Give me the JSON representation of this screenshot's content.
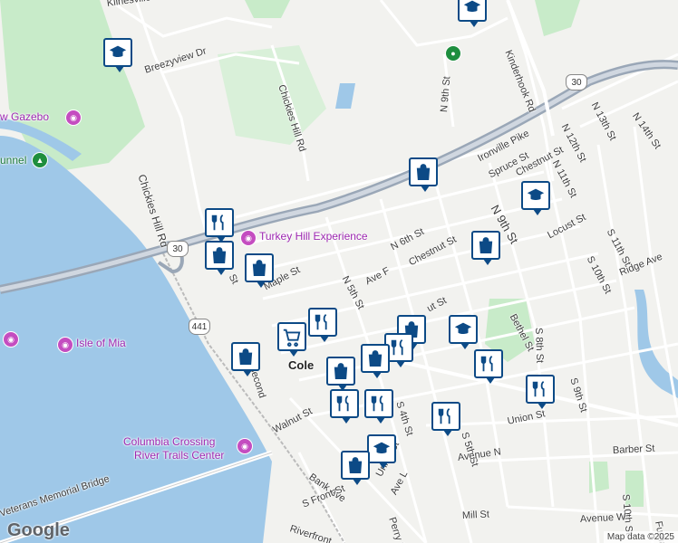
{
  "map": {
    "google_logo": "Google",
    "attribution": "Map data ©2025",
    "colors": {
      "water": "#9fc8e8",
      "park": "#c8ebc9",
      "road": "#ffffff",
      "highway": "#9aa7b7",
      "marker_border": "#0c4a86",
      "poi": "#9c27b0"
    }
  },
  "streets": [
    {
      "name": "Klinesville",
      "id": "klinesville"
    },
    {
      "name": "Breezyview Dr",
      "id": "breezyview"
    },
    {
      "name": "Chickies Hill Rd",
      "id": "chickies-hill-rd-1"
    },
    {
      "name": "Chickies Hill Rd",
      "id": "chickies-hill-rd-2"
    },
    {
      "name": "Kinderhook Rd",
      "id": "kinderhook"
    },
    {
      "name": "N 9th St",
      "id": "n9th-top"
    },
    {
      "name": "N 14th St",
      "id": "n14th"
    },
    {
      "name": "N 13th St",
      "id": "n13th"
    },
    {
      "name": "N 12th St",
      "id": "n12th"
    },
    {
      "name": "N 11th St",
      "id": "n11th"
    },
    {
      "name": "Ironville Pike",
      "id": "ironville"
    },
    {
      "name": "Spruce St",
      "id": "spruce"
    },
    {
      "name": "Chestnut St",
      "id": "chestnut-e"
    },
    {
      "name": "N 9th St",
      "id": "n9th"
    },
    {
      "name": "Locust St",
      "id": "locust-e"
    },
    {
      "name": "S 11th St",
      "id": "s11th"
    },
    {
      "name": "S 10th St",
      "id": "s10th"
    },
    {
      "name": "Ridge Ave",
      "id": "ridge"
    },
    {
      "name": "N 6th St",
      "id": "n6th"
    },
    {
      "name": "Chestnut St",
      "id": "chestnut"
    },
    {
      "name": "N 5th St",
      "id": "n5th"
    },
    {
      "name": "Ave F",
      "id": "avef"
    },
    {
      "name": "Maple St",
      "id": "maple"
    },
    {
      "name": "Walnut St",
      "id": "walnut"
    },
    {
      "name": "Bethel St",
      "id": "bethel"
    },
    {
      "name": "S 8th St",
      "id": "s8th"
    },
    {
      "name": "S 9th St",
      "id": "s9th"
    },
    {
      "name": "Union St",
      "id": "union-e"
    },
    {
      "name": "S 5th St",
      "id": "s5th"
    },
    {
      "name": "S 4th St",
      "id": "s4th"
    },
    {
      "name": "Avenue N",
      "id": "aven"
    },
    {
      "name": "Barber St",
      "id": "barber"
    },
    {
      "name": "S 10th St",
      "id": "s10th-b"
    },
    {
      "name": "Union St",
      "id": "union"
    },
    {
      "name": "Ave L",
      "id": "avel"
    },
    {
      "name": "Bank Ave",
      "id": "bank"
    },
    {
      "name": "S Front St",
      "id": "sfront"
    },
    {
      "name": "Perry St",
      "id": "perry"
    },
    {
      "name": "Mill St",
      "id": "mill"
    },
    {
      "name": "Avenue W",
      "id": "avew"
    },
    {
      "name": "Riverfront",
      "id": "riverfront"
    },
    {
      "name": "Furnac",
      "id": "furnace"
    },
    {
      "name": "Chickies Hill Rd",
      "id": "chickies-main"
    },
    {
      "name": "Second",
      "id": "second"
    },
    {
      "name": "Veterans Memorial Bridge",
      "id": "veterans"
    },
    {
      "name": "Lo",
      "id": "lo"
    },
    {
      "name": "ut St",
      "id": "ut-st"
    },
    {
      "name": "St",
      "id": "st1"
    },
    {
      "name": "S",
      "id": "s-frag"
    },
    {
      "name": "St",
      "id": "st2"
    },
    {
      "name": "Cole",
      "id": "city"
    }
  ],
  "places": {
    "gazebo": "w Gazebo",
    "tunnel": "unnel",
    "turkey_hill": "Turkey Hill Experience",
    "isle_of_mia": "Isle of Mia",
    "columbia_crossing_1": "Columbia Crossing",
    "columbia_crossing_2": "River Trails Center"
  },
  "shields": [
    "30",
    "30",
    "441"
  ],
  "markers": [
    {
      "type": "school",
      "id": "m1"
    },
    {
      "type": "school",
      "id": "m2"
    },
    {
      "type": "shopping",
      "id": "m3"
    },
    {
      "type": "school",
      "id": "m4"
    },
    {
      "type": "restaurant",
      "id": "m5"
    },
    {
      "type": "shopping",
      "id": "m6"
    },
    {
      "type": "shopping",
      "id": "m7"
    },
    {
      "type": "shopping",
      "id": "m8"
    },
    {
      "type": "restaurant",
      "id": "m9"
    },
    {
      "type": "grocery",
      "id": "m10"
    },
    {
      "type": "shopping",
      "id": "m11"
    },
    {
      "type": "school",
      "id": "m12"
    },
    {
      "type": "restaurant",
      "id": "m13"
    },
    {
      "type": "restaurant",
      "id": "m14"
    },
    {
      "type": "shopping",
      "id": "m15"
    },
    {
      "type": "restaurant",
      "id": "m16"
    },
    {
      "type": "restaurant",
      "id": "m17"
    },
    {
      "type": "restaurant",
      "id": "m18"
    },
    {
      "type": "school",
      "id": "m19"
    },
    {
      "type": "shopping",
      "id": "m20"
    },
    {
      "type": "shopping",
      "id": "m21"
    }
  ]
}
